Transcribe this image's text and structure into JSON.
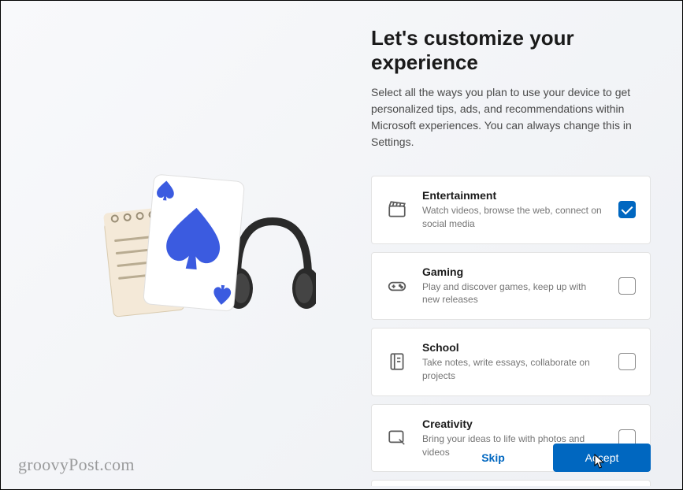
{
  "header": {
    "title": "Let's customize your experience",
    "subtitle": "Select all the ways you plan to use your device to get personalized tips, ads, and recommendations within Microsoft experiences. You can always change this in Settings."
  },
  "options": [
    {
      "icon": "clapperboard-icon",
      "title": "Entertainment",
      "desc": "Watch videos, browse the web, connect on social media",
      "checked": true
    },
    {
      "icon": "gamepad-icon",
      "title": "Gaming",
      "desc": "Play and discover games, keep up with new releases",
      "checked": false
    },
    {
      "icon": "notebook-icon",
      "title": "School",
      "desc": "Take notes, write essays, collaborate on projects",
      "checked": false
    },
    {
      "icon": "pen-tablet-icon",
      "title": "Creativity",
      "desc": "Bring your ideas to life with photos and videos",
      "checked": false
    }
  ],
  "footer": {
    "skip_label": "Skip",
    "accept_label": "Accept"
  },
  "watermark": "groovyPost.com",
  "colors": {
    "accent": "#0067c0"
  }
}
